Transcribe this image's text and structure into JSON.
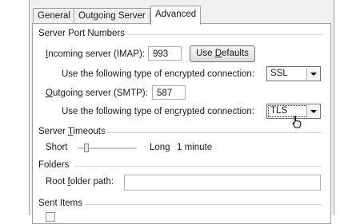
{
  "tabs": {
    "general": "General",
    "outgoing": "Outgoing Server",
    "advanced": "Advanced"
  },
  "server_ports": {
    "title": "Server Port Numbers",
    "incoming_pre": "I",
    "incoming_post": "ncoming server (IMAP):",
    "incoming_value": "993",
    "use_defaults_pre": "Use ",
    "use_defaults_key": "D",
    "use_defaults_post": "efaults",
    "enc_label_1_pre": "Use the following type of encrypted connection:",
    "enc_value_1": "SSL",
    "outgoing_pre": "O",
    "outgoing_post": "utgoing server (SMTP):",
    "outgoing_value": "587",
    "enc_label_2_pre": "Use the following type of en",
    "enc_label_2_key": "c",
    "enc_label_2_post": "rypted connection:",
    "enc_value_2": "TLS"
  },
  "timeouts": {
    "title_pre": "Server ",
    "title_key": "T",
    "title_post": "imeouts",
    "short": "Short",
    "long": "Long",
    "value": "1 minute",
    "slider_level": 0.12
  },
  "folders": {
    "title": "Folders",
    "root_pre": "Root ",
    "root_key": "f",
    "root_post": "older path:",
    "root_value": ""
  },
  "sent_items": {
    "title": "Sent Items"
  }
}
